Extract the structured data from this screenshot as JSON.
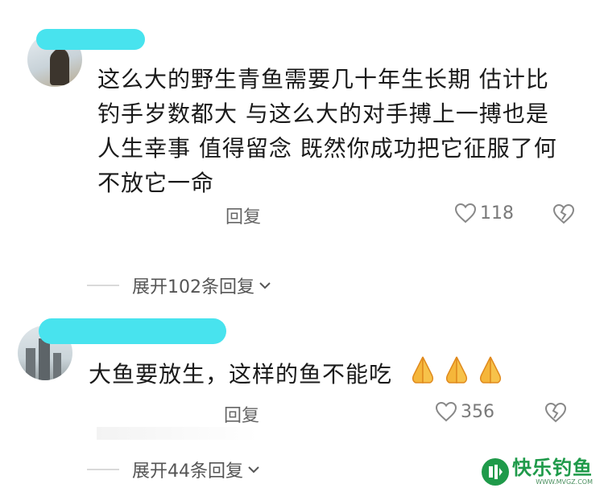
{
  "comments": [
    {
      "lines": [
        "这么大的野生青鱼需要几十年生长期 估计比",
        "钓手岁数都大 与这么大的对手搏上一搏也是",
        "人生幸事 值得留念 既然你成功把它征服了何",
        "不放它一命"
      ],
      "reply_label": "回复",
      "likes": "118",
      "expand_label": "展开102条回复"
    },
    {
      "text": "大鱼要放生，这样的鱼不能吃",
      "emoji": [
        "praying-hands",
        "praying-hands",
        "praying-hands"
      ],
      "reply_label": "回复",
      "likes": "356",
      "expand_label": "展开44条回复"
    }
  ],
  "watermark": {
    "title": "快乐钓鱼",
    "subtitle": "WWW.MVGZ.COM"
  },
  "colors": {
    "name_redaction": "#48e3ee",
    "watermark_green": "#1f9a4a"
  }
}
